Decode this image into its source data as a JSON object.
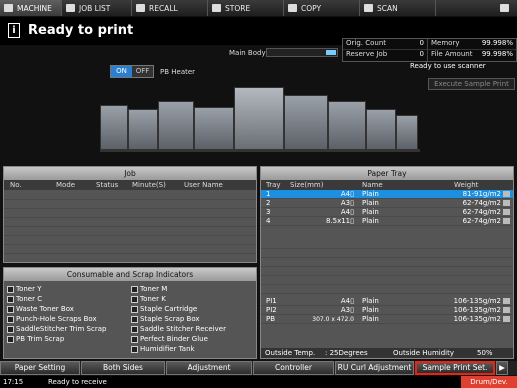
{
  "top_tabs": [
    "MACHINE",
    "JOB LIST",
    "RECALL",
    "STORE",
    "COPY",
    "SCAN"
  ],
  "title": "Ready to print",
  "counters": {
    "orig_count_label": "Orig. Count",
    "orig_count_value": "0",
    "memory_label": "Memory",
    "memory_value": "99.998%",
    "reserve_job_label": "Reserve Job",
    "reserve_job_value": "0",
    "file_amount_label": "File Amount",
    "file_amount_value": "99.998%"
  },
  "main_body_label": "Main Body",
  "ready_to_use_scanner": "Ready to use scanner",
  "execute_sample_print": "Execute Sample Print",
  "pb_heater": {
    "on": "ON",
    "off": "OFF",
    "label": "PB Heater"
  },
  "job_panel": {
    "title": "Job",
    "columns": [
      "No.",
      "Mode",
      "Status",
      "Minute(S)",
      "User Name"
    ]
  },
  "consumables": {
    "title": "Consumable and Scrap Indicators",
    "items": [
      "Toner Y",
      "Toner M",
      "Toner C",
      "Toner K",
      "Waste Toner Box",
      "Staple Cartridge",
      "Punch-Hole Scraps Box",
      "Staple Scrap Box",
      "SaddleStitcher Trim Scrap",
      "Saddle Stitcher Receiver",
      "PB Trim Scrap",
      "Perfect Binder Glue",
      "",
      "Humidifier Tank"
    ]
  },
  "paper_tray": {
    "title": "Paper Tray",
    "columns": [
      "Tray",
      "Size(mm)",
      "Name",
      "Weight"
    ],
    "rows": [
      {
        "tray": "1",
        "size": "A4▯",
        "name": "Plain",
        "weight": "81-91g/m2",
        "selected": true
      },
      {
        "tray": "2",
        "size": "A3▯",
        "name": "Plain",
        "weight": "62-74g/m2",
        "selected": false
      },
      {
        "tray": "3",
        "size": "A4▯",
        "name": "Plain",
        "weight": "62-74g/m2",
        "selected": false
      },
      {
        "tray": "4",
        "size": "8.5x11▯",
        "name": "Plain",
        "weight": "62-74g/m2",
        "selected": false
      }
    ],
    "lower_rows": [
      {
        "tray": "PI1",
        "size": "A4▯",
        "name": "Plain",
        "weight": "106-135g/m2"
      },
      {
        "tray": "PI2",
        "size": "A3▯",
        "name": "Plain",
        "weight": "106-135g/m2"
      },
      {
        "tray": "PB",
        "size": "307.0 x 472.0",
        "name": "Plain",
        "weight": "106-135g/m2"
      }
    ],
    "outside_temp_label": "Outside Temp.",
    "outside_temp_value": ": 25Degrees",
    "outside_humidity_label": "Outside Humidity",
    "outside_humidity_value": "50%"
  },
  "bottom_buttons": [
    "Paper Setting",
    "Both Sides",
    "Adjustment",
    "Controller",
    "RU Curl Adjustment",
    "Sample Print Set.",
    "▶"
  ],
  "status": {
    "time": "17:15",
    "message": "Ready to receive",
    "drum": "Drum/Dev."
  },
  "colors": {
    "selected_row": "#1d8fe0",
    "highlight_border": "#e21",
    "on_button": "#2a7fd0"
  }
}
